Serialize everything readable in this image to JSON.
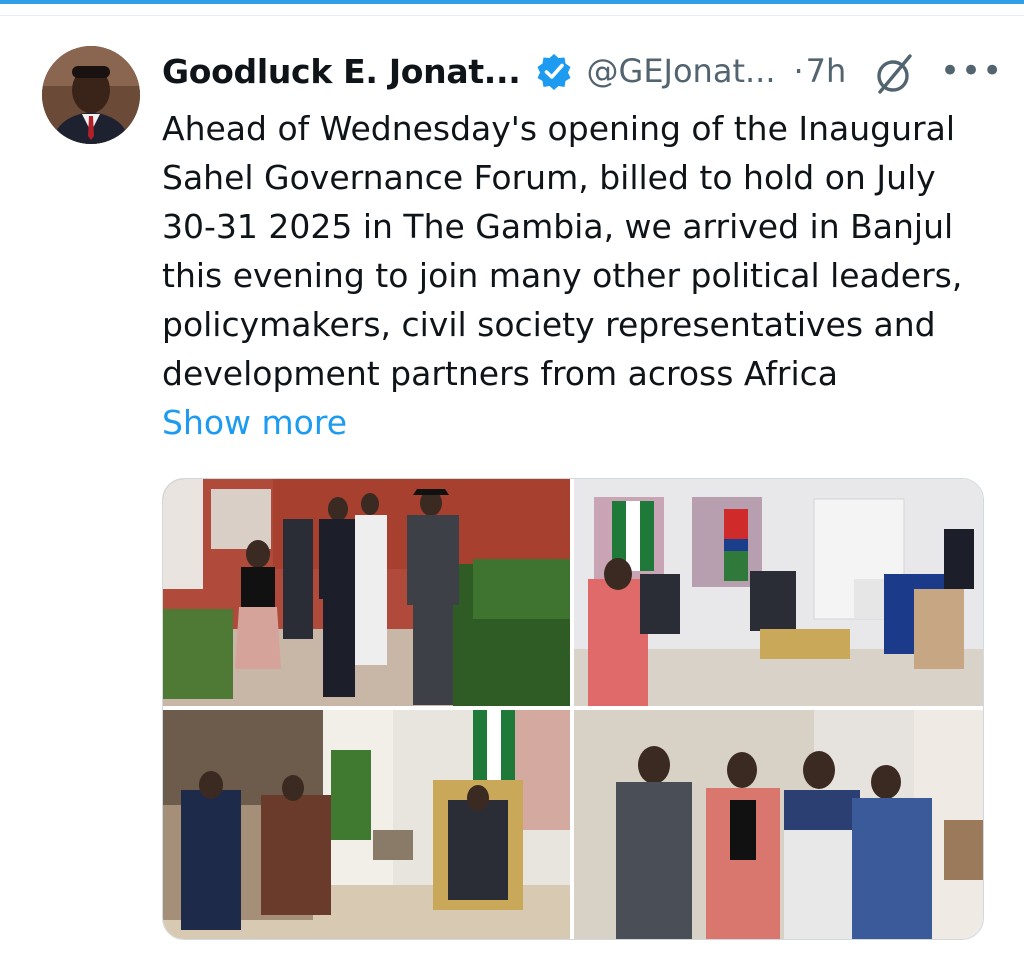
{
  "tweet": {
    "author_name": "Goodluck E. Jonat...",
    "handle": "@GEJonat...",
    "separator": "·",
    "time": "7h",
    "verified": true,
    "text": "Ahead of Wednesday's opening of the Inaugural\nSahel Governance Forum, billed to hold on July\n30-31 2025 in The Gambia, we arrived in Banjul\nthis evening to join many other political leaders,\npolicymakers, civil society representatives and\ndevelopment partners from across Africa",
    "show_more": "Show more",
    "more_menu": "•••"
  },
  "icons": {
    "verified": "verified-badge-icon",
    "grok": "grok-icon",
    "more": "more-options-icon"
  },
  "colors": {
    "accent": "#1d9bf0",
    "secondary_text": "#536471",
    "top_bar": "#2f9fe8"
  },
  "media": {
    "photos": [
      {
        "name": "photo-delegation-walking"
      },
      {
        "name": "photo-meeting-room-flags"
      },
      {
        "name": "photo-seated-meeting"
      },
      {
        "name": "photo-group-portrait"
      }
    ]
  }
}
